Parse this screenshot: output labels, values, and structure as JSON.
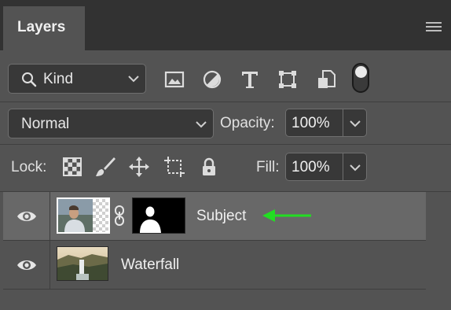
{
  "panel": {
    "tab_title": "Layers",
    "menu_icon": "hamburger-icon"
  },
  "filter": {
    "kind_label": "Kind",
    "icons": [
      "image-filter-icon",
      "adjustment-filter-icon",
      "type-filter-icon",
      "shape-filter-icon",
      "smart-object-filter-icon"
    ],
    "filter_toggle_on": true
  },
  "blend": {
    "mode": "Normal",
    "opacity_label": "Opacity:",
    "opacity_value": "100%"
  },
  "lock": {
    "label": "Lock:",
    "icons": [
      "lock-transparent-pixels-icon",
      "lock-image-pixels-icon",
      "lock-position-icon",
      "lock-artboard-icon",
      "lock-all-icon"
    ],
    "fill_label": "Fill:",
    "fill_value": "100%"
  },
  "layers": [
    {
      "name": "Subject",
      "selected": true,
      "visible": true,
      "has_mask": true
    },
    {
      "name": "Waterfall",
      "selected": false,
      "visible": true,
      "has_mask": false
    }
  ],
  "annotation": {
    "arrow_color": "#22dd22"
  }
}
